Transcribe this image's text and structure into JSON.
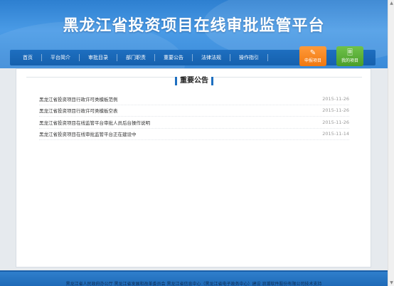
{
  "site": {
    "title": "黑龙江省投资项目在线审批监管平台"
  },
  "nav": {
    "items": [
      {
        "label": "首页"
      },
      {
        "label": "平台简介"
      },
      {
        "label": "审批目录"
      },
      {
        "label": "部门职责"
      },
      {
        "label": "重要公告"
      },
      {
        "label": "法律法规"
      },
      {
        "label": "操作指引"
      }
    ]
  },
  "quick": {
    "declare_label": "申报项目",
    "mine_label": "我的项目",
    "declare_icon": "edit-icon",
    "mine_icon": "document-icon",
    "declare_color": "#f07810",
    "mine_color": "#4a9e2a"
  },
  "section": {
    "title": "重要公告"
  },
  "notices": [
    {
      "title": "黑龙江省投资项目行政许可类模板范例",
      "date": "2015-11-26"
    },
    {
      "title": "黑龙江省投资项目行政许可类模板空表",
      "date": "2015-11-26"
    },
    {
      "title": "黑龙江省投资项目在线监管平台审批人员后台操作说明",
      "date": "2015-11-26"
    },
    {
      "title": "黑龙江省投资项目在线审批监管平台正在建设中",
      "date": "2015-11-14"
    }
  ],
  "footer": {
    "text": "黑龙江省人民政府办公厅    黑龙江省发展和改革委员会    黑龙江省信息中心（黑龙江省电子政务中心）建设    浪潮软件股份有限公司技术支持"
  },
  "colors": {
    "nav": "#1e6fc0",
    "header": "#3a8ad8"
  }
}
